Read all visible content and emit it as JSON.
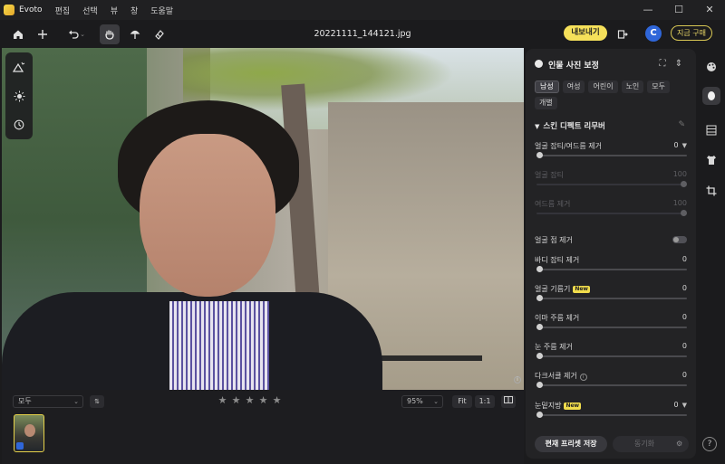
{
  "app": {
    "name": "Evoto",
    "menu": [
      "편집",
      "선택",
      "뷰",
      "창",
      "도움말"
    ],
    "window_controls": {
      "minimize": "—",
      "maximize": "☐",
      "close": "✕"
    }
  },
  "toolbar": {
    "filename": "20221111_144121.jpg",
    "export_label": "내보내기",
    "avatar_letter": "C",
    "buy_label": "지금 구매"
  },
  "bottom": {
    "filter_value": "모두",
    "sort_label": "⇅",
    "stars": [
      "★",
      "★",
      "★",
      "★",
      "★"
    ],
    "zoom_value": "95%",
    "fit_label": "Fit",
    "one_to_one_label": "1:1"
  },
  "panel": {
    "title": "인물 사진 보정",
    "tags": [
      "남성",
      "여성",
      "어린이",
      "노인",
      "모두",
      "개별"
    ],
    "selected_tag": "남성",
    "section_title": "스킨 디펙트 리무버",
    "sliders": {
      "blemish_all": {
        "label": "얼굴 잡티/여드름 제거",
        "value": "0",
        "level": 0
      },
      "blemish": {
        "label": "얼굴 잡티",
        "value": "100",
        "level": 100
      },
      "acne": {
        "label": "여드름 제거",
        "value": "100",
        "level": 100
      },
      "spot_label": "얼굴 점 제거",
      "body_blemish": {
        "label": "바디 잡티 제거",
        "value": "0",
        "level": 0
      },
      "face_oil": {
        "label": "얼굴 기름기",
        "value": "0",
        "level": 0,
        "badge": "New"
      },
      "forehead": {
        "label": "이마 주름 제거",
        "value": "0",
        "level": 0
      },
      "eye_wrinkle": {
        "label": "눈 주름 제거",
        "value": "0",
        "level": 0
      },
      "dark_circle": {
        "label": "다크서클 제거",
        "value": "0",
        "level": 0
      },
      "eye_bag": {
        "label": "눈밑지방",
        "value": "0",
        "level": 0,
        "badge": "New"
      }
    },
    "save_preset_label": "편재 프리셋 저장",
    "sync_label": "동기화"
  },
  "colors": {
    "accent": "#f5e05a",
    "avatar": "#2f66d9"
  }
}
